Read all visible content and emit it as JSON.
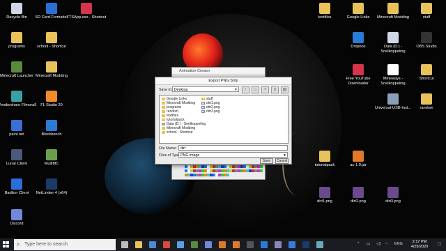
{
  "desktop": {
    "left_icons": [
      {
        "label": "Recycle Bin",
        "icon": "recycle-bin-icon",
        "color": "#cfd9e6"
      },
      {
        "label": "SD Card Formatter",
        "icon": "sd-card-icon",
        "color": "#2a6fd6"
      },
      {
        "label": "TTSApp.exe - Shortcut",
        "icon": "tts-app-icon",
        "color": "#d6344a"
      },
      {
        "label": "programs",
        "icon": "folder-icon",
        "color": "#e8c25a"
      },
      {
        "label": "school - Shortcut",
        "icon": "folder-icon",
        "color": "#e8c25a"
      },
      {
        "label": "Minecraft Launcher",
        "icon": "minecraft-icon",
        "color": "#5b8a3a"
      },
      {
        "label": "Minecraft Modding",
        "icon": "folder-icon",
        "color": "#e8c25a"
      },
      {
        "label": "Wondershare Filmora9",
        "icon": "filmora-icon",
        "color": "#3aa0a0"
      },
      {
        "label": "FL Studio 20",
        "icon": "fl-studio-icon",
        "color": "#f08a2a"
      },
      {
        "label": "paint.net",
        "icon": "paintnet-icon",
        "color": "#3a6fd6"
      },
      {
        "label": "Blockbench",
        "icon": "blockbench-icon",
        "color": "#2a7bd6"
      },
      {
        "label": "Lunar Client",
        "icon": "lunar-client-icon",
        "color": "#4a5a7a"
      },
      {
        "label": "MultiMC",
        "icon": "multimc-icon",
        "color": "#6aa04a"
      },
      {
        "label": "Badlion Client",
        "icon": "badlion-icon",
        "color": "#2a6fd6"
      },
      {
        "label": "NetLimiter 4 (x64)",
        "icon": "netlimiter-icon",
        "color": "#1a3a6a"
      },
      {
        "label": "Discord",
        "icon": "discord-icon",
        "color": "#7289da"
      }
    ],
    "right_icons": [
      {
        "label": "textfiles",
        "icon": "folder-icon",
        "color": "#e8c25a"
      },
      {
        "label": "Google Links",
        "icon": "folder-icon",
        "color": "#e8c25a"
      },
      {
        "label": "Minecraft Modding",
        "icon": "folder-icon",
        "color": "#e8c25a"
      },
      {
        "label": "stuff",
        "icon": "folder-icon",
        "color": "#e8c25a"
      },
      {
        "label": "Dropbox",
        "icon": "dropbox-icon",
        "color": "#2a7bd6"
      },
      {
        "label": "Data (D:) - Snelkoppeling",
        "icon": "drive-icon",
        "color": "#cfd9e6"
      },
      {
        "label": "OBS Studio",
        "icon": "obs-icon",
        "color": "#333333"
      },
      {
        "label": "Free YouTube Downloader",
        "icon": "youtube-downloader-icon",
        "color": "#d6344a"
      },
      {
        "label": "Mineways - Snelkoppeling",
        "icon": "mineways-icon",
        "color": "#ffffff"
      },
      {
        "label": "Shortcut",
        "icon": "folder-icon",
        "color": "#e8c25a"
      },
      {
        "label": "Universal-USB-Inst...",
        "icon": "usb-installer-icon",
        "color": "#8aa0b8"
      },
      {
        "label": "random",
        "icon": "folder-icon",
        "color": "#e8c25a"
      },
      {
        "label": "tutorialpack",
        "icon": "folder-icon",
        "color": "#e8c25a"
      },
      {
        "label": "ac-1.0.jar",
        "icon": "java-icon",
        "color": "#e07a2a"
      },
      {
        "label": "dirt1.png",
        "icon": "png-file-icon",
        "color": "#6a4a8a"
      },
      {
        "label": "dirt2.png",
        "icon": "png-file-icon",
        "color": "#6a4a8a"
      },
      {
        "label": "dirt3.png",
        "icon": "png-file-icon",
        "color": "#6a4a8a"
      }
    ]
  },
  "animation_creator": {
    "title": "Animation Creator"
  },
  "dialog": {
    "title": "Export PNG Strip",
    "save_in_label": "Save in:",
    "save_in_value": "Desktop",
    "toolbar_icons": [
      "up-folder-icon",
      "home-icon",
      "new-folder-icon",
      "list-view-icon",
      "details-view-icon"
    ],
    "files_col1": [
      {
        "name": "Google Links",
        "type": "folder"
      },
      {
        "name": "Minecraft Modding",
        "type": "folder"
      },
      {
        "name": "programs",
        "type": "folder"
      },
      {
        "name": "random",
        "type": "folder"
      },
      {
        "name": "textfiles",
        "type": "folder"
      },
      {
        "name": "tutorialpack",
        "type": "folder"
      },
      {
        "name": "Data (D:) - Snelkoppeling",
        "type": "drive"
      },
      {
        "name": "Minecraft Modding",
        "type": "folder"
      },
      {
        "name": "school - Shortcut",
        "type": "folder"
      }
    ],
    "files_col2": [
      {
        "name": "stuff",
        "type": "folder"
      },
      {
        "name": "dirt1.png",
        "type": "png"
      },
      {
        "name": "dirt2.png",
        "type": "png"
      },
      {
        "name": "dirt3.png",
        "type": "png"
      }
    ],
    "file_name_label": "File Name:",
    "file_name_value": "dirt",
    "files_of_type_label": "Files of Type:",
    "files_of_type_value": "PNG image",
    "save_button": "Save",
    "cancel_button": "Cancel"
  },
  "taskbar": {
    "search_placeholder": "Type here to search",
    "apps": [
      "task-view-icon",
      "file-explorer-icon",
      "store-icon",
      "chrome-icon",
      "paint-icon",
      "minecraft-icon",
      "discord-icon",
      "blender-icon",
      "java-icon",
      "obs-icon",
      "dropbox-icon",
      "notepad-icon",
      "mail-icon",
      "netlimiter-icon",
      "photos-icon"
    ],
    "language": "ENG",
    "time": "2:17 PM",
    "date": "4/29/2020"
  }
}
